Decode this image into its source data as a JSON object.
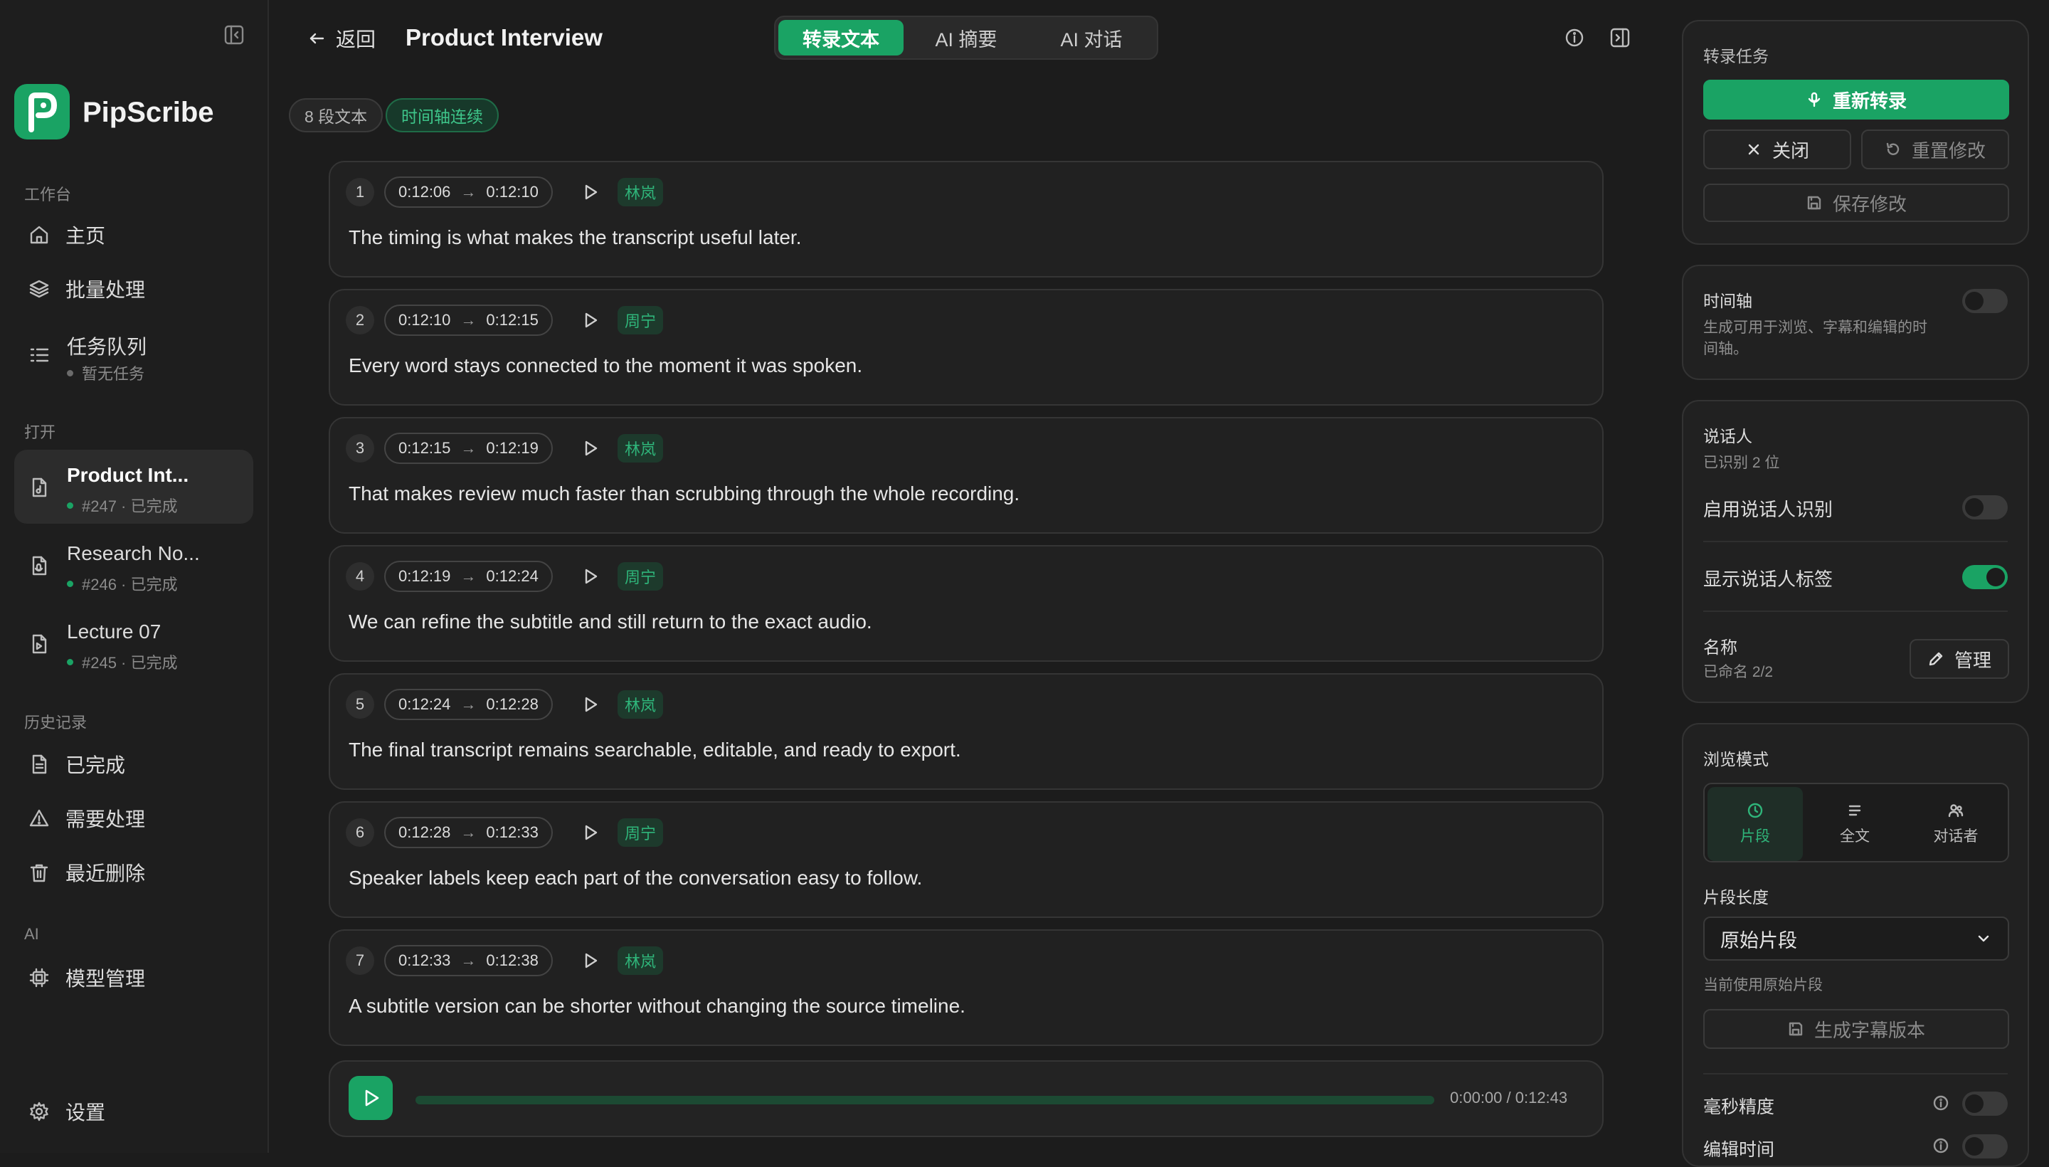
{
  "app": {
    "name": "PipScribe",
    "accent": "#1aa364"
  },
  "sidebar": {
    "sections": {
      "workspace": "工作台",
      "open": "打开",
      "history": "历史记录",
      "ai": "AI"
    },
    "nav": {
      "home": "主页",
      "batch": "批量处理",
      "queue": "任务队列",
      "queue_sub": "暂无任务"
    },
    "open_files": [
      {
        "title": "Product Int...",
        "meta": "#247 · 已完成"
      },
      {
        "title": "Research No...",
        "meta": "#246 · 已完成"
      },
      {
        "title": "Lecture 07",
        "meta": "#245 · 已完成"
      }
    ],
    "history": {
      "done": "已完成",
      "attention": "需要处理",
      "deleted": "最近删除"
    },
    "ai": {
      "models": "模型管理"
    },
    "settings": "设置"
  },
  "header": {
    "back": "返回",
    "title": "Product Interview",
    "tabs": [
      "转录文本",
      "AI 摘要",
      "AI 对话"
    ]
  },
  "chips": {
    "count": "8 段文本",
    "timeline": "时间轴连续"
  },
  "segments": [
    {
      "n": "1",
      "start": "0:12:06",
      "end": "0:12:10",
      "speaker": "林岚",
      "text": "The timing is what makes the transcript useful later."
    },
    {
      "n": "2",
      "start": "0:12:10",
      "end": "0:12:15",
      "speaker": "周宁",
      "text": "Every word stays connected to the moment it was spoken."
    },
    {
      "n": "3",
      "start": "0:12:15",
      "end": "0:12:19",
      "speaker": "林岚",
      "text": "That makes review much faster than scrubbing through the whole recording."
    },
    {
      "n": "4",
      "start": "0:12:19",
      "end": "0:12:24",
      "speaker": "周宁",
      "text": "We can refine the subtitle and still return to the exact audio."
    },
    {
      "n": "5",
      "start": "0:12:24",
      "end": "0:12:28",
      "speaker": "林岚",
      "text": "The final transcript remains searchable, editable, and ready to export."
    },
    {
      "n": "6",
      "start": "0:12:28",
      "end": "0:12:33",
      "speaker": "周宁",
      "text": "Speaker labels keep each part of the conversation easy to follow."
    },
    {
      "n": "7",
      "start": "0:12:33",
      "end": "0:12:38",
      "speaker": "林岚",
      "text": "A subtitle version can be shorter without changing the source timeline."
    }
  ],
  "player": {
    "time": "0:00:00 / 0:12:43",
    "progress": 0
  },
  "panel": {
    "task": {
      "title": "转录任务",
      "retranscribe": "重新转录",
      "close": "关闭",
      "reset": "重置修改",
      "save": "保存修改"
    },
    "timeline": {
      "title": "时间轴",
      "desc1": "生成可用于浏览、字幕和编辑的时",
      "desc2": "间轴。",
      "enabled": false
    },
    "speakers": {
      "title": "说话人",
      "sub": "已识别 2 位",
      "enable_label": "启用说话人识别",
      "enable": false,
      "show_label": "显示说话人标签",
      "show": true,
      "names_label": "名称",
      "names_sub": "已命名 2/2",
      "manage": "管理"
    },
    "view": {
      "title": "浏览模式",
      "modes": [
        "片段",
        "全文",
        "对话者"
      ],
      "selected": "片段",
      "seg_len_label": "片段长度",
      "seg_len_value": "原始片段",
      "seg_len_hint": "当前使用原始片段",
      "generate": "生成字幕版本",
      "ms_label": "毫秒精度",
      "ms": false,
      "edit_label": "编辑时间",
      "edit": false
    }
  }
}
